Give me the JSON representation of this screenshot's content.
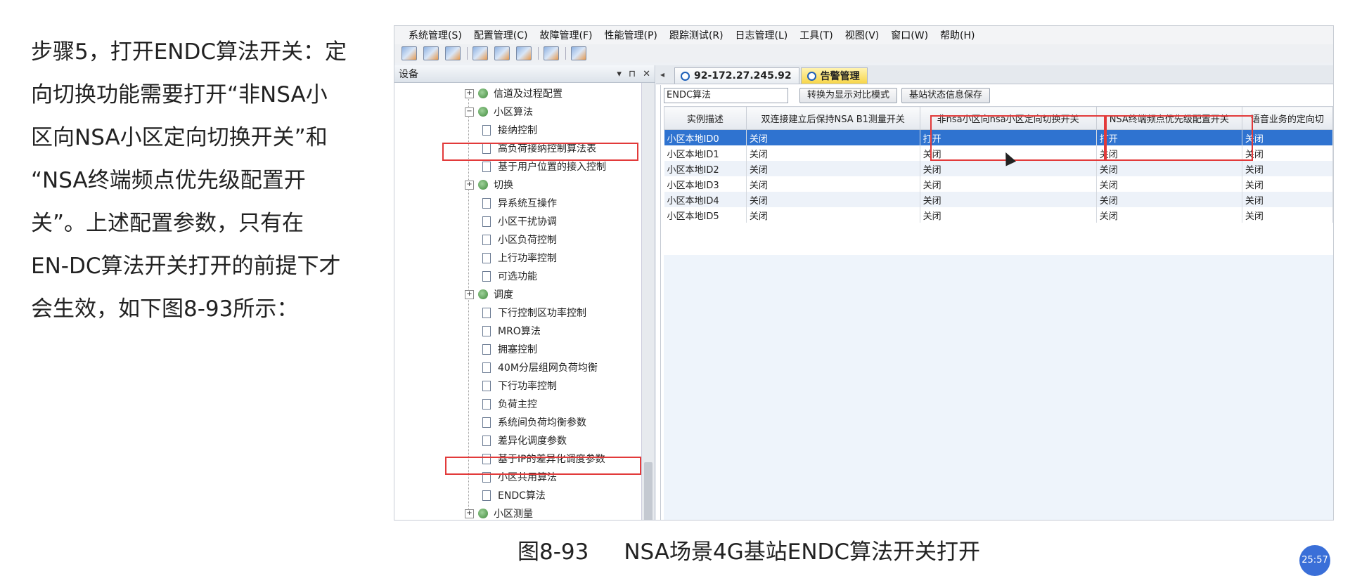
{
  "left_text": {
    "lines": [
      "步骤5，打开ENDC算法开关：定",
      "向切换功能需要打开“非NSA小",
      "区向NSA小区定向切换开关”和",
      "“NSA终端频点优先级配置开",
      "关”。上述配置参数，只有在",
      "EN-DC算法开关打开的前提下才",
      "会生效，如下图8-93所示："
    ]
  },
  "menu": [
    "系统管理(S)",
    "配置管理(C)",
    "故障管理(F)",
    "性能管理(P)",
    "跟踪测试(R)",
    "日志管理(L)",
    "工具(T)",
    "视图(V)",
    "窗口(W)",
    "帮助(H)"
  ],
  "toolbar_icons": [
    "config-icon",
    "table-icon",
    "chart-icon",
    "monitor-icon",
    "list-icon",
    "export-icon",
    "alarm-icon",
    "settings-icon"
  ],
  "tree_panel": {
    "title": "设备",
    "controls": [
      "▾",
      "⊓",
      "✕"
    ],
    "items": [
      {
        "label": "信道及过程配置",
        "kind": "folder"
      },
      {
        "label": "小区算法",
        "kind": "folder"
      },
      {
        "label": "接纳控制",
        "kind": "leaf"
      },
      {
        "label": "高负荷接纳控制算法表",
        "kind": "leaf"
      },
      {
        "label": "基于用户位置的接入控制",
        "kind": "leaf"
      },
      {
        "label": "切换",
        "kind": "folder"
      },
      {
        "label": "异系统互操作",
        "kind": "leaf"
      },
      {
        "label": "小区干扰协调",
        "kind": "leaf"
      },
      {
        "label": "小区负荷控制",
        "kind": "leaf"
      },
      {
        "label": "上行功率控制",
        "kind": "leaf"
      },
      {
        "label": "可选功能",
        "kind": "leaf"
      },
      {
        "label": "调度",
        "kind": "folder"
      },
      {
        "label": "下行控制区功率控制",
        "kind": "leaf"
      },
      {
        "label": "MRO算法",
        "kind": "leaf"
      },
      {
        "label": "拥塞控制",
        "kind": "leaf"
      },
      {
        "label": "40M分层组网负荷均衡",
        "kind": "leaf"
      },
      {
        "label": "下行功率控制",
        "kind": "leaf"
      },
      {
        "label": "负荷主控",
        "kind": "leaf"
      },
      {
        "label": "系统间负荷均衡参数",
        "kind": "leaf"
      },
      {
        "label": "差异化调度参数",
        "kind": "leaf"
      },
      {
        "label": "基于IP的差异化调度参数",
        "kind": "leaf"
      },
      {
        "label": "小区共用算法",
        "kind": "leaf"
      },
      {
        "label": "ENDC算法",
        "kind": "leaf"
      },
      {
        "label": "小区测量",
        "kind": "folder"
      }
    ]
  },
  "tabs": [
    {
      "label": "92-172.27.245.92",
      "icon": "network-element-icon"
    },
    {
      "label": "告警管理",
      "icon": "alarm-icon"
    }
  ],
  "content": {
    "field_value": "ENDC算法",
    "buttons": [
      "转换为显示对比模式",
      "基站状态信息保存"
    ],
    "columns": [
      "实例描述",
      "双连接建立后保持NSA B1测量开关",
      "非nsa小区向nsa小区定向切换开关",
      "NSA终端频点优先级配置开关",
      "语音业务的定向切"
    ],
    "rows": [
      [
        "小区本地ID0",
        "关闭",
        "打开",
        "打开",
        "关闭"
      ],
      [
        "小区本地ID1",
        "关闭",
        "关闭",
        "关闭",
        "关闭"
      ],
      [
        "小区本地ID2",
        "关闭",
        "关闭",
        "关闭",
        "关闭"
      ],
      [
        "小区本地ID3",
        "关闭",
        "关闭",
        "关闭",
        "关闭"
      ],
      [
        "小区本地ID4",
        "关闭",
        "关闭",
        "关闭",
        "关闭"
      ],
      [
        "小区本地ID5",
        "关闭",
        "关闭",
        "关闭",
        "关闭"
      ]
    ],
    "selected_row": 0
  },
  "caption": {
    "fig": "图8-93",
    "text": "NSA场景4G基站ENDC算法开关打开"
  },
  "badge": "25:57",
  "colors": {
    "highlight": "#e23a3a",
    "selection": "#2f73d0",
    "tab_warn": "#f7d64a"
  }
}
